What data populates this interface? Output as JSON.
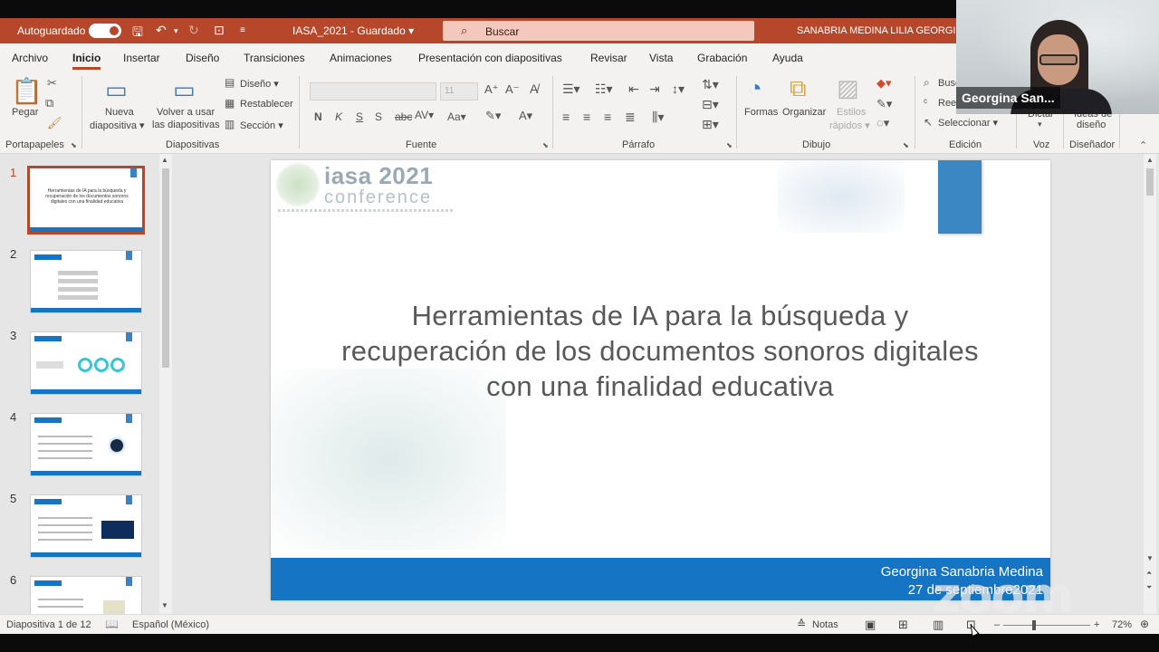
{
  "titlebar": {
    "autosave_label": "Autoguardado",
    "doc_title": "IASA_2021 - Guardado ▾",
    "search_placeholder": "Buscar",
    "user_name": "SANABRIA MEDINA LILIA GEORGINA"
  },
  "tabs": [
    "Archivo",
    "Inicio",
    "Insertar",
    "Diseño",
    "Transiciones",
    "Animaciones",
    "Presentación con diapositivas",
    "Revisar",
    "Vista",
    "Grabación",
    "Ayuda"
  ],
  "ribbon": {
    "paste": "Pegar",
    "new_slide": [
      "Nueva",
      "diapositiva ▾"
    ],
    "reuse_slides": [
      "Volver a usar",
      "las diapositivas"
    ],
    "layout": "Diseño ▾",
    "reset": "Restablecer",
    "section": "Sección ▾",
    "font_size": "11",
    "shapes": "Formas",
    "arrange": "Organizar",
    "quick_styles": [
      "Estilos",
      "rápidos ▾"
    ],
    "search": "Buscar",
    "replace": "Reemplazar",
    "select": "Seleccionar ▾",
    "dictate": "Dictar",
    "design_ideas": [
      "Ideas de",
      "diseño"
    ],
    "groups": {
      "clipboard": "Portapapeles",
      "slides": "Diapositivas",
      "font": "Fuente",
      "paragraph": "Párrafo",
      "drawing": "Dibujo",
      "editing": "Edición",
      "voice": "Voz",
      "designer": "Diseñador"
    }
  },
  "thumbnails": [
    {
      "num": "1",
      "title": "Herramientas de IA para la búsqueda y recuperación de los documentos sonoros digitales con una finalidad educativa"
    },
    {
      "num": "2"
    },
    {
      "num": "3"
    },
    {
      "num": "4"
    },
    {
      "num": "5"
    },
    {
      "num": "6"
    }
  ],
  "slide": {
    "logo_main": "iasa 2021",
    "logo_sub": "conference",
    "title": "Herramientas de IA para la búsqueda y recuperación de los documentos sonoros digitales con una finalidad educativa",
    "footer_name": "Georgina Sanabria Medina",
    "footer_date": "27 de septiembre2021"
  },
  "status": {
    "slide_count": "Diapositiva 1 de 12",
    "language": "Español (México)",
    "notes": "Notas",
    "zoom_level": "72%",
    "zoom_value": 0.35
  },
  "webcam": {
    "participant": "Georgina San..."
  },
  "watermark": "zoom",
  "colors": {
    "accent": "#b7472a",
    "slide_blue": "#1574c4"
  }
}
